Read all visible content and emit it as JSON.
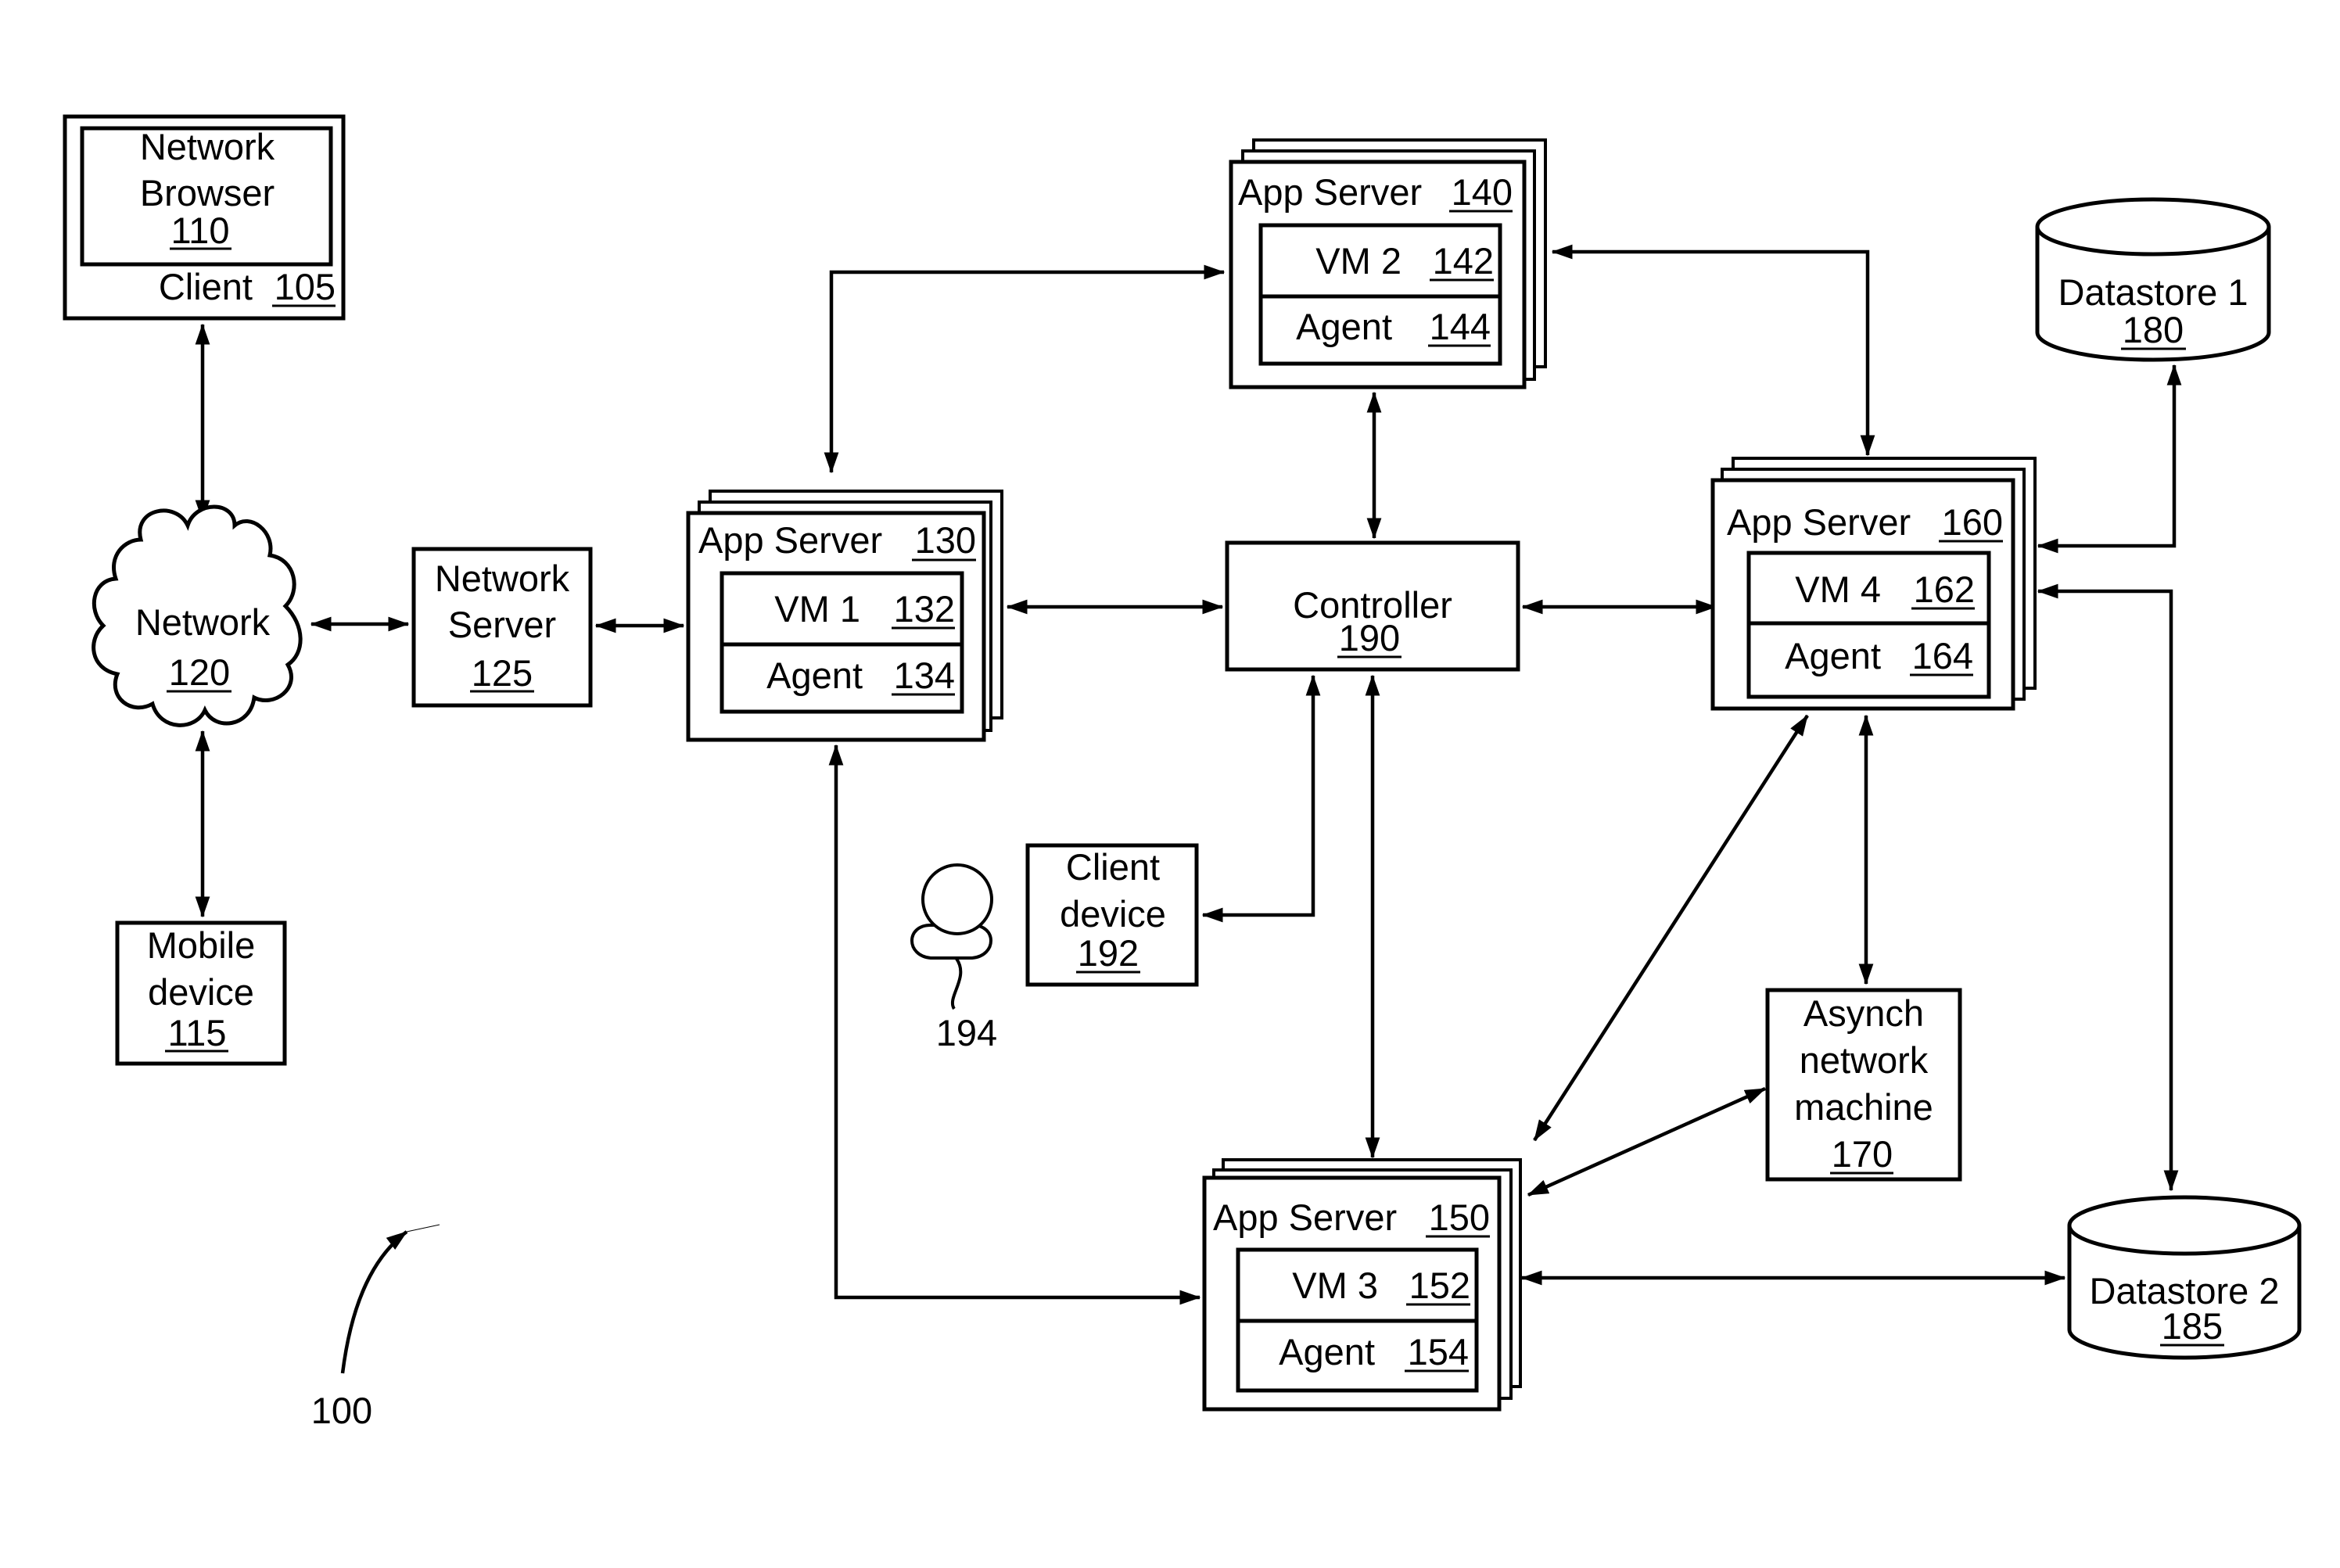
{
  "figure": {
    "reference_number": "100"
  },
  "client": {
    "browser_title_line1": "Network",
    "browser_title_line2": "Browser",
    "browser_number": "110",
    "label": "Client",
    "number": "105"
  },
  "network": {
    "label": "Network",
    "number": "120"
  },
  "network_server": {
    "label_line1": "Network",
    "label_line2": "Server",
    "number": "125"
  },
  "mobile_device": {
    "label_line1": "Mobile",
    "label_line2": "device",
    "number": "115"
  },
  "app_servers": {
    "s130": {
      "label": "App Server",
      "number": "130",
      "vm_label": "VM 1",
      "vm_number": "132",
      "agent_label": "Agent",
      "agent_number": "134"
    },
    "s140": {
      "label": "App Server",
      "number": "140",
      "vm_label": "VM 2",
      "vm_number": "142",
      "agent_label": "Agent",
      "agent_number": "144"
    },
    "s150": {
      "label": "App Server",
      "number": "150",
      "vm_label": "VM 3",
      "vm_number": "152",
      "agent_label": "Agent",
      "agent_number": "154"
    },
    "s160": {
      "label": "App Server",
      "number": "160",
      "vm_label": "VM 4",
      "vm_number": "162",
      "agent_label": "Agent",
      "agent_number": "164"
    }
  },
  "controller": {
    "label": "Controller",
    "number": "190"
  },
  "client_device": {
    "label_line1": "Client",
    "label_line2": "device",
    "number": "192"
  },
  "user": {
    "number": "194"
  },
  "asynch": {
    "label_line1": "Asynch",
    "label_line2": "network",
    "label_line3": "machine",
    "number": "170"
  },
  "datastore1": {
    "label": "Datastore 1",
    "number": "180"
  },
  "datastore2": {
    "label": "Datastore 2",
    "number": "185"
  }
}
